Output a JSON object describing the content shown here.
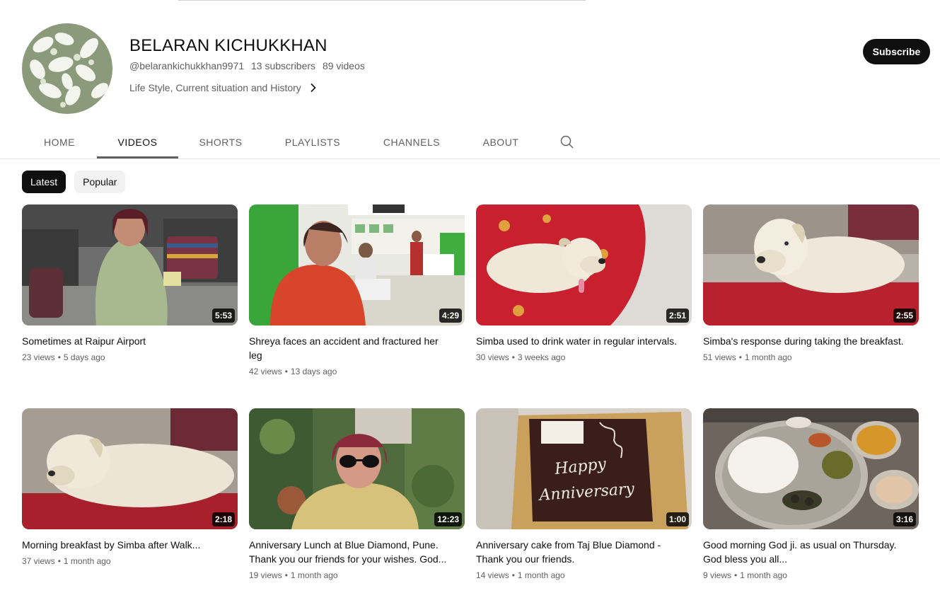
{
  "channel": {
    "name": "BELARAN KICHUKKHAN",
    "handle": "@belarankichukkhan9971",
    "subscribers": "13 subscribers",
    "videos_count": "89 videos",
    "description": "Life Style, Current situation and History",
    "subscribe_label": "Subscribe"
  },
  "tabs": [
    {
      "label": "HOME"
    },
    {
      "label": "VIDEOS"
    },
    {
      "label": "SHORTS"
    },
    {
      "label": "PLAYLISTS"
    },
    {
      "label": "CHANNELS"
    },
    {
      "label": "ABOUT"
    }
  ],
  "chips": [
    {
      "label": "Latest"
    },
    {
      "label": "Popular"
    }
  ],
  "videos": [
    {
      "title": "Sometimes at Raipur Airport",
      "duration": "5:53",
      "views": "23 views",
      "age": "5 days ago"
    },
    {
      "title": "Shreya faces an accident and fractured her leg",
      "duration": "4:29",
      "views": "42 views",
      "age": "13 days ago"
    },
    {
      "title": "Simba used to drink water in regular intervals.",
      "duration": "2:51",
      "views": "30 views",
      "age": "3 weeks ago"
    },
    {
      "title": "Simba's response during taking the breakfast.",
      "duration": "2:55",
      "views": "51 views",
      "age": "1 month ago"
    },
    {
      "title": "Morning breakfast by Simba after Walk...",
      "duration": "2:18",
      "views": "37 views",
      "age": "1 month ago"
    },
    {
      "title": "Anniversary Lunch at Blue Diamond, Pune. Thank you our friends for your wishes. God...",
      "duration": "12:23",
      "views": "19 views",
      "age": "1 month ago"
    },
    {
      "title": "Anniversary cake from Taj Blue Diamond - Thank you our friends.",
      "duration": "1:00",
      "views": "14 views",
      "age": "1 month ago"
    },
    {
      "title": "Good morning God ji. as usual on Thursday. God bless you all...",
      "duration": "3:16",
      "views": "9 views",
      "age": "1 month ago"
    }
  ],
  "colors": {
    "text_primary": "#0f0f0f",
    "text_secondary": "#606060",
    "chip_bg": "#f2f2f2",
    "subscribe_bg": "#0f0f0f"
  }
}
